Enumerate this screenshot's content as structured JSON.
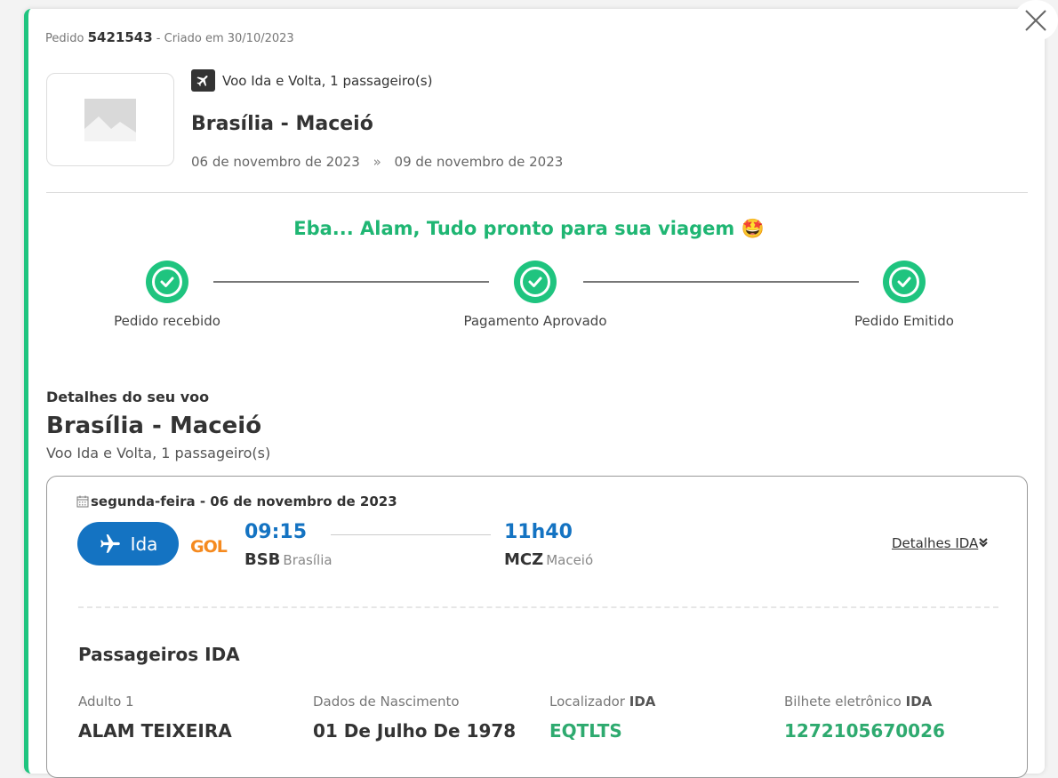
{
  "order": {
    "label": "Pedido",
    "number": "5421543",
    "created": "- Criado em 30/10/2023"
  },
  "trip": {
    "type_text": "Voo Ida e Volta, 1 passageiro(s)",
    "route": "Brasília - Maceió",
    "date_start": "06 de novembro de 2023",
    "date_sep": "»",
    "date_end": "09 de novembro de 2023"
  },
  "status": {
    "message": "Eba... Alam, Tudo pronto para sua viagem",
    "emoji": "🤩",
    "steps": [
      {
        "label": "Pedido recebido"
      },
      {
        "label": "Pagamento Aprovado"
      },
      {
        "label": "Pedido Emitido"
      }
    ]
  },
  "details": {
    "subtitle": "Detalhes do seu voo",
    "title": "Brasília - Maceió",
    "type_text": "Voo Ida e Volta, 1 passageiro(s)"
  },
  "flight": {
    "date": "segunda-feira - 06 de novembro de 2023",
    "direction_label": "Ida",
    "airline": "GOL",
    "depart_time": "09:15",
    "depart_code": "BSB",
    "depart_city": "Brasília",
    "arrive_time": "11h40",
    "arrive_code": "MCZ",
    "arrive_city": "Maceió",
    "details_link": "Detalhes IDA"
  },
  "passengers": {
    "title": "Passageiros IDA",
    "adult_label": "Adulto 1",
    "name": "ALAM TEIXEIRA",
    "birth_label": "Dados de Nascimento",
    "birth_value": "01 De Julho De 1978",
    "locator_label": "Localizador",
    "locator_suffix": "IDA",
    "locator_value": "EQTLTS",
    "ticket_label": "Bilhete eletrônico",
    "ticket_suffix": "IDA",
    "ticket_value": "1272105670026"
  },
  "colors": {
    "accent_green": "#1fc47f",
    "brand_blue": "#1473c2",
    "gol_orange": "#f58a1f"
  }
}
